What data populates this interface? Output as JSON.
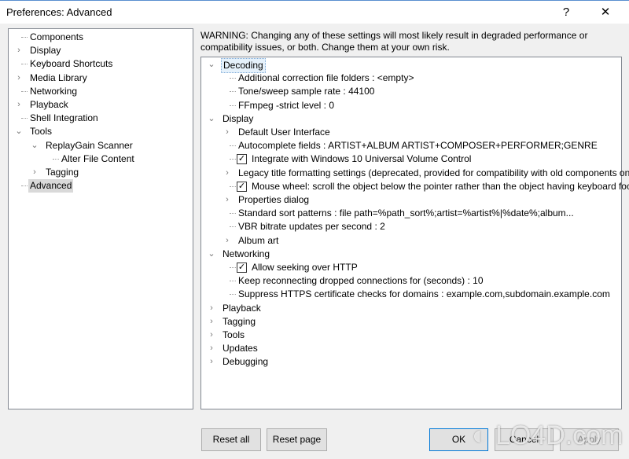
{
  "window": {
    "title": "Preferences: Advanced",
    "help_label": "?",
    "close_label": "✕"
  },
  "left_tree": [
    {
      "label": "Components",
      "level": 0,
      "expander": ""
    },
    {
      "label": "Display",
      "level": 0,
      "expander": "collapsed"
    },
    {
      "label": "Keyboard Shortcuts",
      "level": 0,
      "expander": ""
    },
    {
      "label": "Media Library",
      "level": 0,
      "expander": "collapsed"
    },
    {
      "label": "Networking",
      "level": 0,
      "expander": ""
    },
    {
      "label": "Playback",
      "level": 0,
      "expander": "collapsed"
    },
    {
      "label": "Shell Integration",
      "level": 0,
      "expander": ""
    },
    {
      "label": "Tools",
      "level": 0,
      "expander": "expanded"
    },
    {
      "label": "ReplayGain Scanner",
      "level": 1,
      "expander": "expanded"
    },
    {
      "label": "Alter File Content",
      "level": 2,
      "expander": ""
    },
    {
      "label": "Tagging",
      "level": 1,
      "expander": "collapsed"
    },
    {
      "label": "Advanced",
      "level": 0,
      "expander": "",
      "selected": true
    }
  ],
  "warning": "WARNING: Changing any of these settings will most likely result in degraded performance or compatibility issues, or both. Change them at your own risk.",
  "right_tree": [
    {
      "label": "Decoding",
      "level": 0,
      "expander": "expanded",
      "selected": true
    },
    {
      "label": "Additional correction file folders : <empty>",
      "level": 1,
      "expander": ""
    },
    {
      "label": "Tone/sweep sample rate : 44100",
      "level": 1,
      "expander": ""
    },
    {
      "label": "FFmpeg -strict level : 0",
      "level": 1,
      "expander": ""
    },
    {
      "label": "Display",
      "level": 0,
      "expander": "expanded"
    },
    {
      "label": "Default User Interface",
      "level": 1,
      "expander": "collapsed"
    },
    {
      "label": "Autocomplete fields : ARTIST+ALBUM ARTIST+COMPOSER+PERFORMER;GENRE",
      "level": 1,
      "expander": ""
    },
    {
      "label": "Integrate with Windows 10 Universal Volume Control",
      "level": 1,
      "expander": "",
      "checkbox": true
    },
    {
      "label": "Legacy title formatting settings (deprecated, provided for compatibility with old components only)",
      "level": 1,
      "expander": "collapsed"
    },
    {
      "label": "Mouse wheel: scroll the object below the pointer rather than the object having keyboard focus",
      "level": 1,
      "expander": "",
      "checkbox": true
    },
    {
      "label": "Properties dialog",
      "level": 1,
      "expander": "collapsed"
    },
    {
      "label": "Standard sort patterns : file path=%path_sort%;artist=%artist%|%date%;album...",
      "level": 1,
      "expander": ""
    },
    {
      "label": "VBR bitrate updates per second : 2",
      "level": 1,
      "expander": ""
    },
    {
      "label": "Album art",
      "level": 1,
      "expander": "collapsed"
    },
    {
      "label": "Networking",
      "level": 0,
      "expander": "expanded"
    },
    {
      "label": "Allow seeking over HTTP",
      "level": 1,
      "expander": "",
      "checkbox": true
    },
    {
      "label": "Keep reconnecting dropped connections for (seconds) : 10",
      "level": 1,
      "expander": ""
    },
    {
      "label": "Suppress HTTPS certificate checks for domains : example.com,subdomain.example.com",
      "level": 1,
      "expander": ""
    },
    {
      "label": "Playback",
      "level": 0,
      "expander": "collapsed"
    },
    {
      "label": "Tagging",
      "level": 0,
      "expander": "collapsed"
    },
    {
      "label": "Tools",
      "level": 0,
      "expander": "collapsed"
    },
    {
      "label": "Updates",
      "level": 0,
      "expander": "collapsed"
    },
    {
      "label": "Debugging",
      "level": 0,
      "expander": "collapsed"
    }
  ],
  "buttons": {
    "reset_all": "Reset all",
    "reset_page": "Reset page",
    "ok": "OK",
    "cancel": "Cancel",
    "apply": "Apply"
  },
  "watermark": "LO4D.com"
}
